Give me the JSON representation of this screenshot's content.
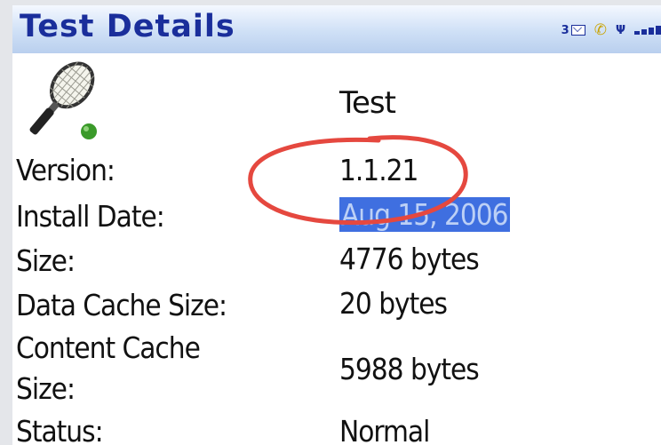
{
  "header": {
    "title": "Test Details",
    "mail_count": "3",
    "icons": [
      "mail-icon",
      "phone-icon",
      "antenna-icon",
      "signal-strength-icon"
    ]
  },
  "app": {
    "icon": "tennis-racket-icon",
    "name": "Test"
  },
  "details": {
    "version_label": "Version:",
    "version_value": "1.1.21",
    "install_date_label": "Install Date:",
    "install_date_value": "Aug 15, 2006",
    "size_label": "Size:",
    "size_value": "4776 bytes",
    "data_cache_label": "Data Cache Size:",
    "data_cache_value": "20 bytes",
    "content_cache_label_1": "Content Cache",
    "content_cache_label_2": "Size:",
    "content_cache_value": "5988 bytes",
    "status_label": "Status:",
    "status_value": "Normal"
  },
  "colors": {
    "title": "#1a2e9b",
    "selection": "#3f6fe0",
    "annotation": "#e5483f"
  }
}
